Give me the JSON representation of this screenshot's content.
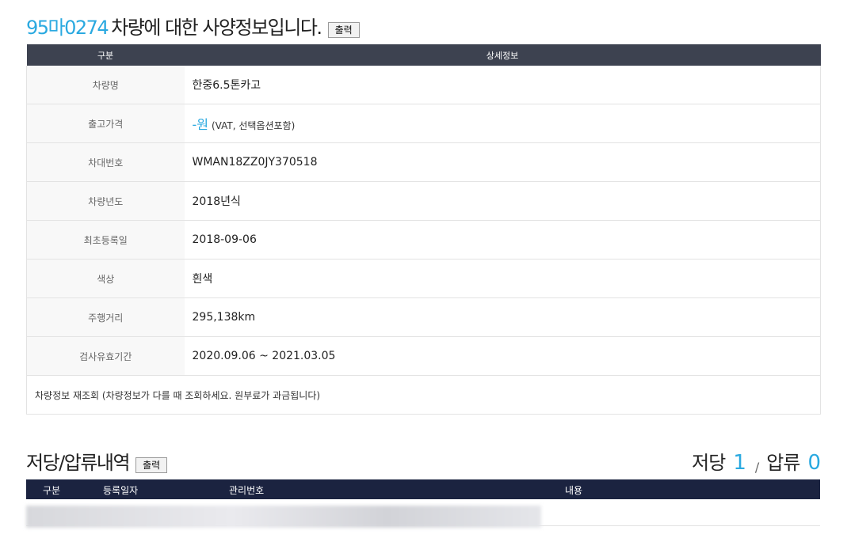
{
  "spec": {
    "plate": "95마0274",
    "title_rest": "차량에 대한 사양정보입니다.",
    "print_label": "출력",
    "col_category": "구분",
    "col_detail": "상세정보",
    "rows": {
      "name_label": "차량명",
      "name_value": "한중6.5톤카고",
      "price_label": "출고가격",
      "price_amount": "-원",
      "price_note": "(VAT, 선택옵션포함)",
      "vin_label": "차대번호",
      "vin_value": "WMAN18ZZ0JY370518",
      "year_label": "차량년도",
      "year_value": "2018년식",
      "reg_label": "최초등록일",
      "reg_value": "2018-09-06",
      "color_label": "색상",
      "color_value": "흰색",
      "mileage_label": "주행거리",
      "mileage_value": "295,138km",
      "inspect_label": "검사유효기간",
      "inspect_value": "2020.09.06 ~ 2021.03.05"
    },
    "requery_note": "차량정보 재조회 (차량정보가 다를 때 조회하세요. 원부료가 과금됩니다)"
  },
  "lien": {
    "title": "저당/압류내역",
    "print_label": "출력",
    "mortgage_label": "저당",
    "mortgage_count": "1",
    "separator": "/",
    "seizure_label": "압류",
    "seizure_count": "0",
    "columns": [
      "구분",
      "등록일자",
      "관리번호",
      "내용"
    ]
  },
  "colors": {
    "accent": "#2aa9e0",
    "table_header": "#3d4250",
    "lien_header": "#1b2340"
  }
}
